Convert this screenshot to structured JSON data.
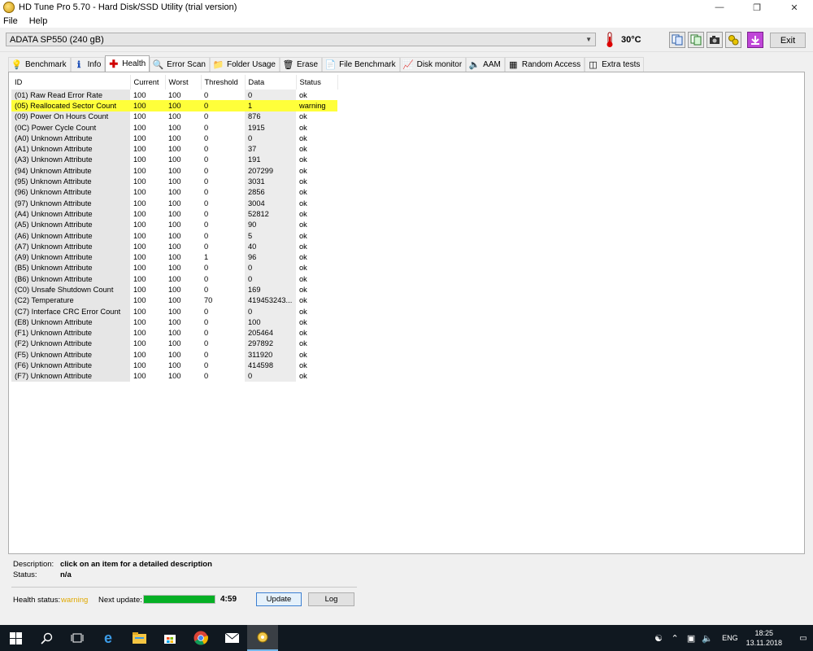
{
  "window": {
    "title": "HD Tune Pro 5.70 - Hard Disk/SSD Utility (trial version)"
  },
  "menu": {
    "file": "File",
    "help": "Help"
  },
  "toolbar": {
    "drive": "ADATA SP550 (240 gB)",
    "temperature": "30°C",
    "exit_label": "Exit"
  },
  "tabs": [
    {
      "label": "Benchmark",
      "icon": "bulb-icon"
    },
    {
      "label": "Info",
      "icon": "info-icon"
    },
    {
      "label": "Health",
      "icon": "health-cross-icon"
    },
    {
      "label": "Error Scan",
      "icon": "magnifier-icon"
    },
    {
      "label": "Folder Usage",
      "icon": "folder-icon"
    },
    {
      "label": "Erase",
      "icon": "trash-icon"
    },
    {
      "label": "File Benchmark",
      "icon": "file-benchmark-icon"
    },
    {
      "label": "Disk monitor",
      "icon": "monitor-chart-icon"
    },
    {
      "label": "AAM",
      "icon": "speaker-icon"
    },
    {
      "label": "Random Access",
      "icon": "random-access-icon"
    },
    {
      "label": "Extra tests",
      "icon": "extra-tests-icon"
    }
  ],
  "table": {
    "headers": {
      "id": "ID",
      "current": "Current",
      "worst": "Worst",
      "threshold": "Threshold",
      "data": "Data",
      "status": "Status"
    },
    "rows": [
      [
        "(01) Raw Read Error Rate",
        "100",
        "100",
        "0",
        "0",
        "ok"
      ],
      [
        "(05) Reallocated Sector Count",
        "100",
        "100",
        "0",
        "1",
        "warning"
      ],
      [
        "(09) Power On Hours Count",
        "100",
        "100",
        "0",
        "876",
        "ok"
      ],
      [
        "(0C) Power Cycle Count",
        "100",
        "100",
        "0",
        "1915",
        "ok"
      ],
      [
        "(A0) Unknown Attribute",
        "100",
        "100",
        "0",
        "0",
        "ok"
      ],
      [
        "(A1) Unknown Attribute",
        "100",
        "100",
        "0",
        "37",
        "ok"
      ],
      [
        "(A3) Unknown Attribute",
        "100",
        "100",
        "0",
        "191",
        "ok"
      ],
      [
        "(94) Unknown Attribute",
        "100",
        "100",
        "0",
        "207299",
        "ok"
      ],
      [
        "(95) Unknown Attribute",
        "100",
        "100",
        "0",
        "3031",
        "ok"
      ],
      [
        "(96) Unknown Attribute",
        "100",
        "100",
        "0",
        "2856",
        "ok"
      ],
      [
        "(97) Unknown Attribute",
        "100",
        "100",
        "0",
        "3004",
        "ok"
      ],
      [
        "(A4) Unknown Attribute",
        "100",
        "100",
        "0",
        "52812",
        "ok"
      ],
      [
        "(A5) Unknown Attribute",
        "100",
        "100",
        "0",
        "90",
        "ok"
      ],
      [
        "(A6) Unknown Attribute",
        "100",
        "100",
        "0",
        "5",
        "ok"
      ],
      [
        "(A7) Unknown Attribute",
        "100",
        "100",
        "0",
        "40",
        "ok"
      ],
      [
        "(A9) Unknown Attribute",
        "100",
        "100",
        "1",
        "96",
        "ok"
      ],
      [
        "(B5) Unknown Attribute",
        "100",
        "100",
        "0",
        "0",
        "ok"
      ],
      [
        "(B6) Unknown Attribute",
        "100",
        "100",
        "0",
        "0",
        "ok"
      ],
      [
        "(C0) Unsafe Shutdown Count",
        "100",
        "100",
        "0",
        "169",
        "ok"
      ],
      [
        "(C2) Temperature",
        "100",
        "100",
        "70",
        "419453243...",
        "ok"
      ],
      [
        "(C7) Interface CRC Error Count",
        "100",
        "100",
        "0",
        "0",
        "ok"
      ],
      [
        "(E8) Unknown Attribute",
        "100",
        "100",
        "0",
        "100",
        "ok"
      ],
      [
        "(F1) Unknown Attribute",
        "100",
        "100",
        "0",
        "205464",
        "ok"
      ],
      [
        "(F2) Unknown Attribute",
        "100",
        "100",
        "0",
        "297892",
        "ok"
      ],
      [
        "(F5) Unknown Attribute",
        "100",
        "100",
        "0",
        "311920",
        "ok"
      ],
      [
        "(F6) Unknown Attribute",
        "100",
        "100",
        "0",
        "414598",
        "ok"
      ],
      [
        "(F7) Unknown Attribute",
        "100",
        "100",
        "0",
        "0",
        "ok"
      ]
    ],
    "warning_row_color": "#ffff3a"
  },
  "description": {
    "desc_label": "Description:",
    "desc_value": "click on an item for a detailed description",
    "status_label": "Status:",
    "status_value": "n/a"
  },
  "health": {
    "status_label": "Health status:",
    "status_value": "warning",
    "status_color": "#e0a800",
    "next_update_label": "Next update:",
    "next_update_time": "4:59",
    "progress_fraction": 1.0,
    "update_label": "Update",
    "log_label": "Log"
  },
  "taskbar": {
    "items": [
      "start-icon",
      "search-icon",
      "task-view-icon",
      "edge-icon",
      "file-explorer-icon",
      "store-icon",
      "chrome-icon",
      "mail-icon",
      "hdtune-icon"
    ],
    "lang": "ENG",
    "time": "18:25",
    "date": "13.11.2018"
  }
}
